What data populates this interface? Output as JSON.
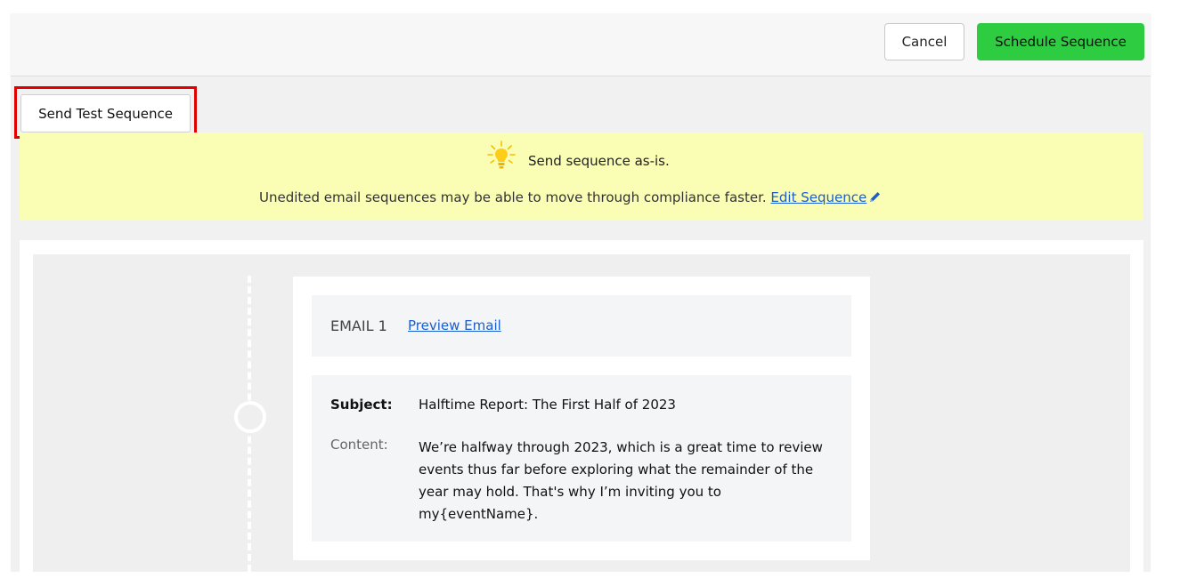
{
  "header": {
    "cancel_label": "Cancel",
    "schedule_label": "Schedule Sequence"
  },
  "test_button_label": "Send Test Sequence",
  "banner": {
    "title": "Send sequence as-is.",
    "text": "Unedited email sequences may be able to move through compliance faster.",
    "edit_link": "Edit Sequence",
    "icons": [
      "lightbulb-icon",
      "pencil-icon"
    ]
  },
  "email": {
    "label": "EMAIL 1",
    "preview_link": "Preview Email",
    "subject_label": "Subject:",
    "subject": "Halftime Report: The First Half of 2023",
    "content_label": "Content:",
    "content": " We’re halfway through 2023, which is a great time to review events thus far before exploring what the remainder of the year may hold. That's why I’m inviting you to my{eventName}."
  },
  "colors": {
    "accent_green": "#2ecc40",
    "banner_yellow": "#fafdb4",
    "highlight_red": "#e00000",
    "link_blue": "#1a5fd1"
  }
}
